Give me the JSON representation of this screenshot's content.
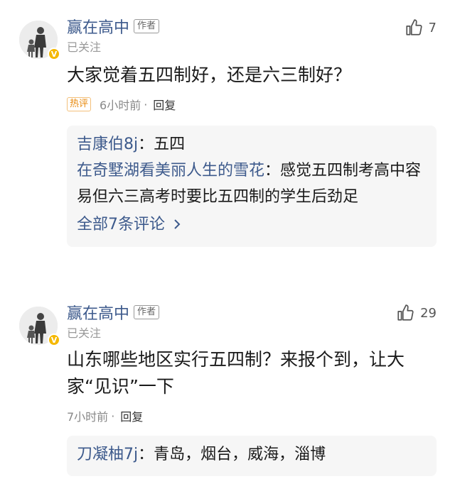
{
  "comments": [
    {
      "username": "赢在高中",
      "author_tag": "作者",
      "follow_status": "已关注",
      "likes": "7",
      "content": "大家觉着五四制好，还是六三制好？",
      "hot_tag": "热评",
      "time": "6小时前",
      "separator": "·",
      "reply_label": "回复",
      "replies": [
        {
          "name": "吉康伯8j",
          "colon": "：",
          "text": "五四"
        },
        {
          "name": "在奇墅湖看美丽人生的雪花",
          "colon": "：",
          "text": "感觉五四制考高中容易但六三高考时要比五四制的学生后劲足"
        }
      ],
      "more_label": "全部7条评论"
    },
    {
      "username": "赢在高中",
      "author_tag": "作者",
      "follow_status": "已关注",
      "likes": "29",
      "content": "山东哪些地区实行五四制？来报个到，让大家“见识”一下",
      "time": "7小时前",
      "separator": "·",
      "reply_label": "回复",
      "replies": [
        {
          "name": "刀凝柚7j",
          "colon": "：",
          "text": "青岛，烟台，威海，淄博"
        }
      ]
    }
  ],
  "colors": {
    "link": "#3d5a8c",
    "hot": "#e8890c",
    "badge": "#f5b800",
    "reply_bg": "#f6f6f6"
  }
}
